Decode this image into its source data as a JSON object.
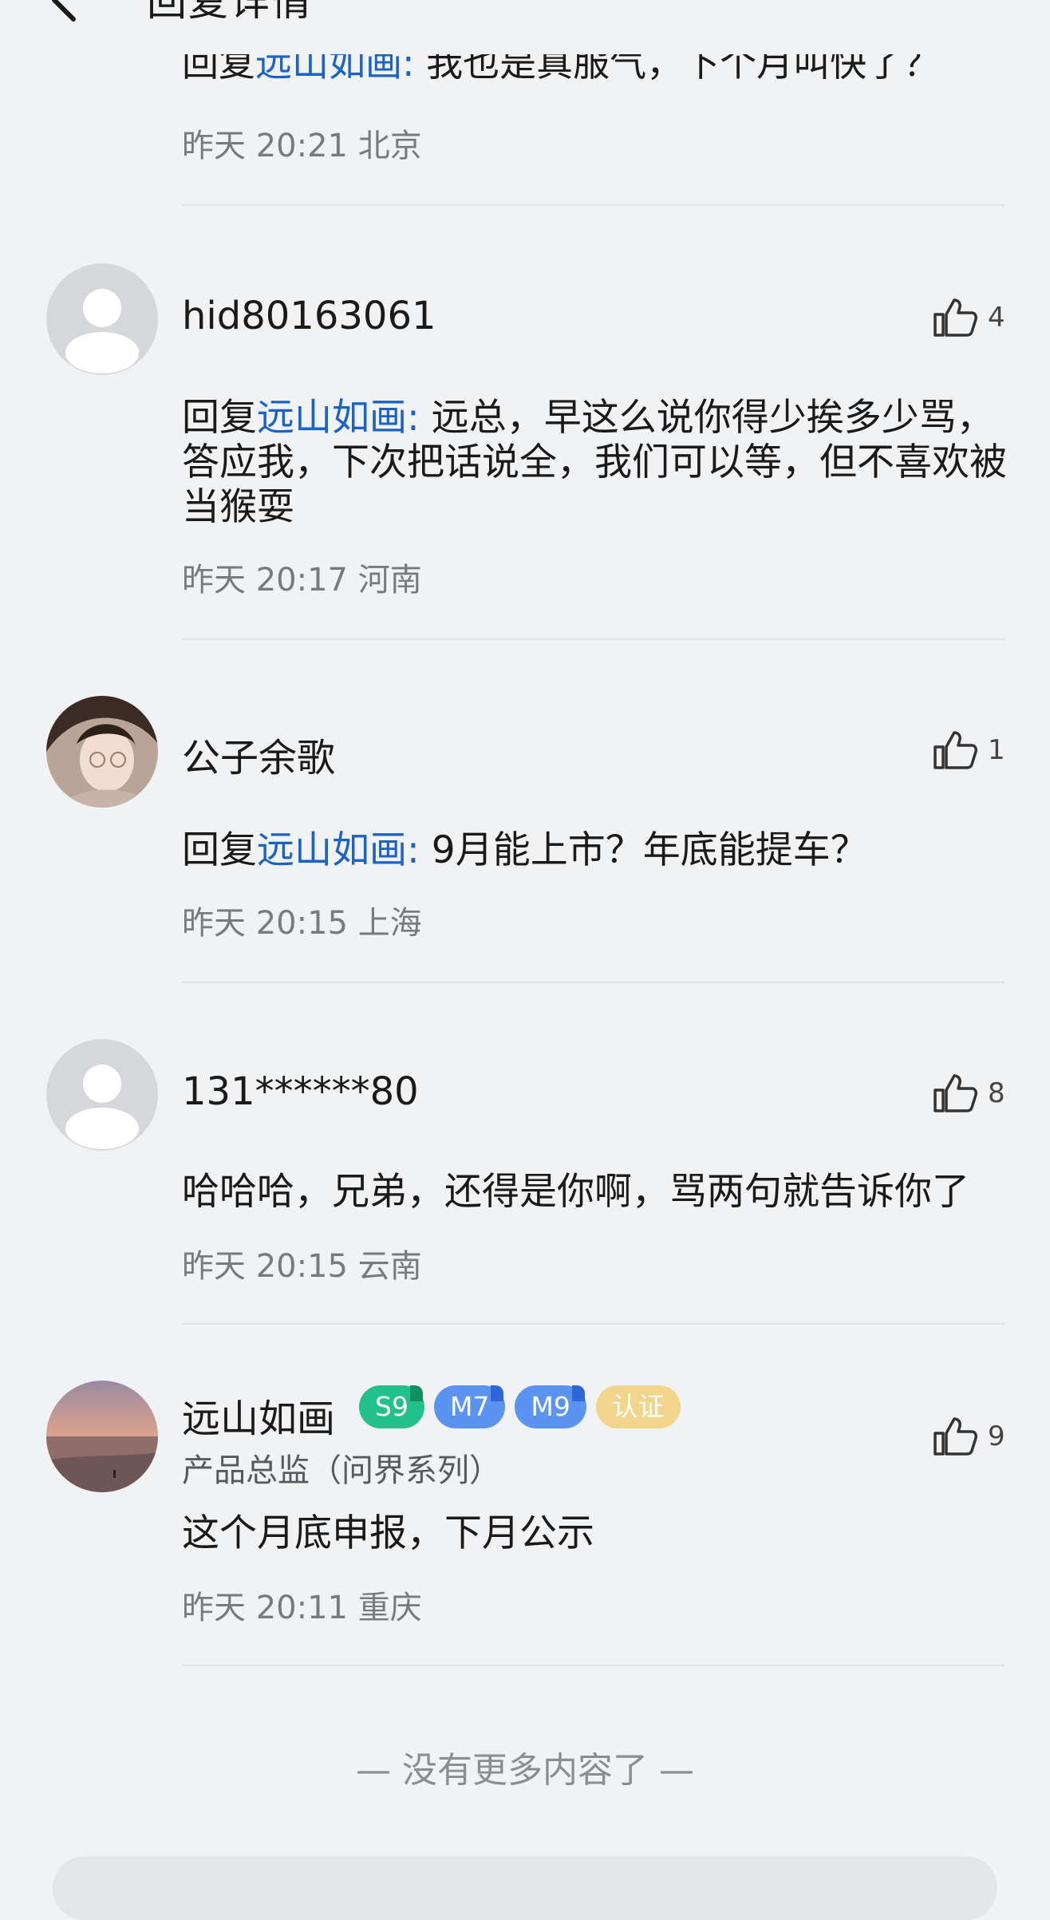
{
  "header": {
    "title": "回复详情"
  },
  "colors": {
    "mention": "#1b62c7",
    "background": "#f1f2f4",
    "badge_s9": "#22c08a",
    "badge_m7": "#4f8ef0",
    "badge_m9": "#4f8ef0",
    "badge_certified": "#f2d48a"
  },
  "top_partial_reply": {
    "prefix": "回复",
    "mention": "远山如画:",
    "text": "我也是真服气，下个月叫快了？",
    "time": "昨天 20:21",
    "location": "北京"
  },
  "comments": [
    {
      "username": "hid80163061",
      "avatar": "default-avatar",
      "likes": "4",
      "prefix": "回复",
      "mention": "远山如画:",
      "text": "远总，早这么说你得少挨多少骂，答应我，下次把话说全，我们可以等，但不喜欢被当猴耍",
      "time": "昨天 20:17",
      "location": "河南"
    },
    {
      "username": "公子余歌",
      "avatar": "photo-avatar-girl",
      "likes": "1",
      "prefix": "回复",
      "mention": "远山如画:",
      "text": "9月能上市？年底能提车？",
      "time": "昨天 20:15",
      "location": "上海"
    },
    {
      "username": "131******80",
      "avatar": "default-avatar",
      "likes": "8",
      "text": "哈哈哈，兄弟，还得是你啊，骂两句就告诉你了",
      "time": "昨天 20:15",
      "location": "云南"
    },
    {
      "username": "远山如画",
      "avatar": "photo-avatar-sunset",
      "likes": "9",
      "badges": [
        "S9",
        "M7",
        "M9",
        "认证"
      ],
      "role": "产品总监（问界系列）",
      "text": "这个月底申报，下月公示",
      "time": "昨天 20:11",
      "location": "重庆"
    }
  ],
  "footer": {
    "end_text": "— 没有更多内容了 —"
  },
  "icons": {
    "back": "chevron-left-icon",
    "like": "thumbs-up-icon"
  }
}
